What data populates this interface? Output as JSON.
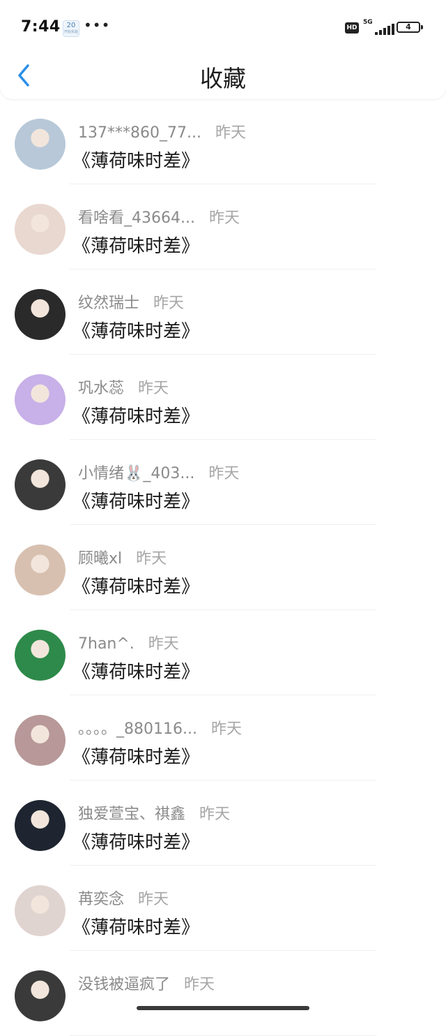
{
  "status_bar": {
    "time": "7:44",
    "notif_badge": "20",
    "notif_badge_sub": "开始实验",
    "more": "•••",
    "hd": "HD",
    "network": "5G",
    "battery": "4"
  },
  "header": {
    "title": "收藏",
    "back_icon": "chevron-left-icon",
    "accent": "#2a8fe8"
  },
  "items": [
    {
      "name": "137***860_77...",
      "time": "昨天",
      "title": "《薄荷味时差》",
      "avatar_color": "#b8c8d8"
    },
    {
      "name": "看啥看_43664...",
      "time": "昨天",
      "title": "《薄荷味时差》",
      "avatar_color": "#e8d8d0"
    },
    {
      "name": "纹然瑞士",
      "time": "昨天",
      "title": "《薄荷味时差》",
      "avatar_color": "#2a2a2a"
    },
    {
      "name": "巩水蕊",
      "time": "昨天",
      "title": "《薄荷味时差》",
      "avatar_color": "#c8b0e8"
    },
    {
      "name": "小情绪🐰_403...",
      "time": "昨天",
      "title": "《薄荷味时差》",
      "avatar_color": "#3a3a3a"
    },
    {
      "name": "顾曦xl",
      "time": "昨天",
      "title": "《薄荷味时差》",
      "avatar_color": "#d8c0b0"
    },
    {
      "name": "7han^.",
      "time": "昨天",
      "title": "《薄荷味时差》",
      "avatar_color": "#2e8a4a"
    },
    {
      "name": "。。。。_880116...",
      "time": "昨天",
      "title": "《薄荷味时差》",
      "avatar_color": "#b89898"
    },
    {
      "name": "独爱萱宝、祺鑫",
      "time": "昨天",
      "title": "《薄荷味时差》",
      "avatar_color": "#1e2530"
    },
    {
      "name": "苒奕念",
      "time": "昨天",
      "title": "《薄荷味时差》",
      "avatar_color": "#e0d4d0"
    },
    {
      "name": "没钱被逼疯了",
      "time": "昨天",
      "title": "",
      "avatar_color": "#3a3a3a"
    }
  ]
}
